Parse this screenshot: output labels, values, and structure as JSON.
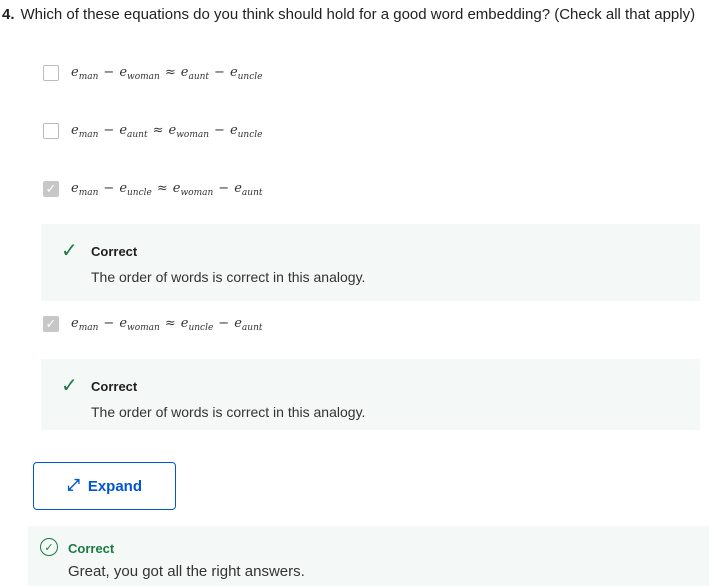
{
  "question": {
    "number": "4.",
    "text": "Which of these equations do you think should hold for a good word embedding? (Check all that apply)"
  },
  "options": [
    {
      "checked": false,
      "terms": [
        "man",
        "woman",
        "aunt",
        "uncle"
      ]
    },
    {
      "checked": false,
      "terms": [
        "man",
        "aunt",
        "woman",
        "uncle"
      ]
    },
    {
      "checked": true,
      "terms": [
        "man",
        "uncle",
        "woman",
        "aunt"
      ]
    },
    {
      "checked": true,
      "terms": [
        "man",
        "woman",
        "uncle",
        "aunt"
      ]
    }
  ],
  "symbols": {
    "e": "e",
    "minus": "−",
    "approx": "≈",
    "check": "✓"
  },
  "feedback": [
    {
      "title": "Correct",
      "message": "The order of words is correct in this analogy."
    },
    {
      "title": "Correct",
      "message": "The order of words is correct in this analogy."
    }
  ],
  "expand_label": "Expand",
  "result": {
    "title": "Correct",
    "message": "Great, you got all the right answers."
  }
}
